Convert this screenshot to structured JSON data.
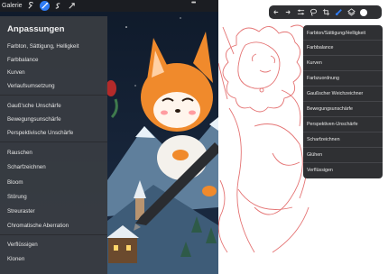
{
  "left_app": {
    "toolbar": {
      "gallery_label": "Galerie",
      "more_label": "•••"
    },
    "menu": {
      "title": "Anpassungen",
      "groups": [
        [
          "Farbton, Sättigung, Helligkeit",
          "Farbbalance",
          "Kurven",
          "Verlaufsumsetzung"
        ],
        [
          "Gauß'sche Unschärfe",
          "Bewegungsunschärfe",
          "Perspektivische Unschärfe"
        ],
        [
          "Rauschen",
          "Scharfzeichnen",
          "Bloom",
          "Störung",
          "Streuraster",
          "Chromatische Aberration"
        ],
        [
          "Verflüssigen",
          "Klonen"
        ]
      ]
    }
  },
  "right_app": {
    "toolbar": {
      "icons": [
        "undo-icon",
        "redo-icon",
        "adjust-icon",
        "lasso-icon",
        "crop-icon",
        "brush-icon",
        "layers-icon",
        "color-icon"
      ]
    },
    "menu": {
      "items": [
        "Farbton/Sättigung/Helligkeit",
        "Farbbalance",
        "Kurven",
        "Farbzuordnung",
        "Gaußscher Weichzeichner",
        "Bewegungsunschärfe",
        "Perspektiven-Unschärfe",
        "Scharfzeichnen",
        "Glühen",
        "Verflüssigen"
      ]
    }
  },
  "colors": {
    "accent": "#2f7cf6",
    "menu_bg": "#3a3d42",
    "sketch_red": "#e05b5b"
  }
}
